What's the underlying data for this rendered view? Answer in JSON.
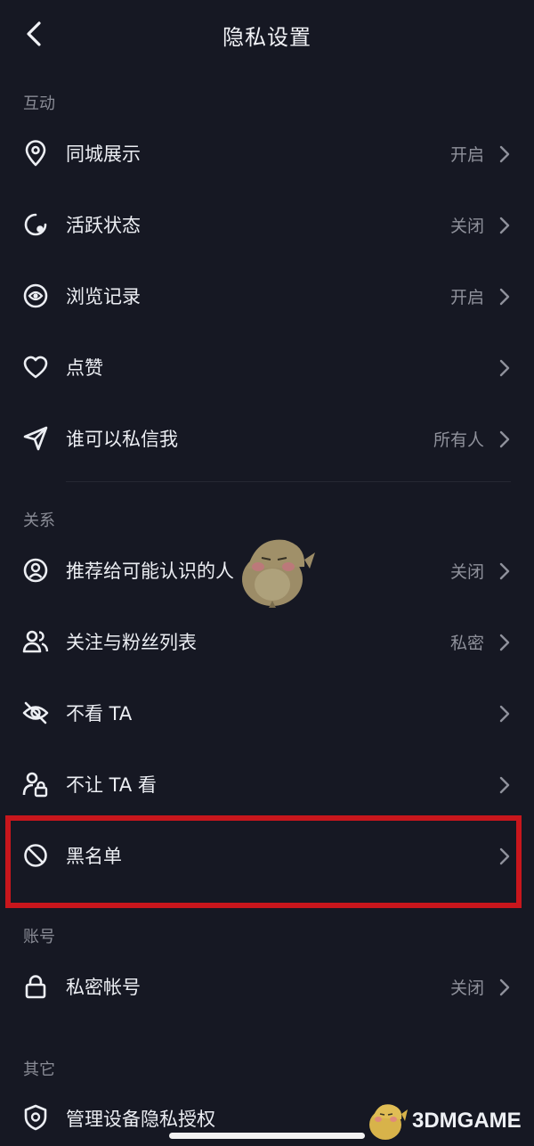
{
  "header": {
    "title": "隐私设置",
    "back_icon": "chevron-left-icon"
  },
  "sections": {
    "interaction": {
      "label": "互动",
      "items": [
        {
          "label": "同城展示",
          "value": "开启",
          "icon": "location-pin-icon"
        },
        {
          "label": "活跃状态",
          "value": "关闭",
          "icon": "activity-status-icon"
        },
        {
          "label": "浏览记录",
          "value": "开启",
          "icon": "eye-icon"
        },
        {
          "label": "点赞",
          "value": "",
          "icon": "heart-icon"
        },
        {
          "label": "谁可以私信我",
          "value": "所有人",
          "icon": "paper-plane-icon"
        }
      ]
    },
    "relations": {
      "label": "关系",
      "items": [
        {
          "label": "推荐给可能认识的人",
          "value": "关闭",
          "icon": "user-circle-icon"
        },
        {
          "label": "关注与粉丝列表",
          "value": "私密",
          "icon": "users-icon"
        },
        {
          "label": "不看 TA",
          "value": "",
          "icon": "eye-off-icon"
        },
        {
          "label": "不让 TA 看",
          "value": "",
          "icon": "user-lock-icon"
        },
        {
          "label": "黑名单",
          "value": "",
          "icon": "block-icon"
        }
      ]
    },
    "account": {
      "label": "账号",
      "items": [
        {
          "label": "私密帐号",
          "value": "关闭",
          "icon": "lock-icon"
        }
      ]
    },
    "other": {
      "label": "其它",
      "items": [
        {
          "label": "管理设备隐私授权",
          "value": "",
          "icon": "shield-icon"
        }
      ]
    }
  },
  "highlight": {
    "target": "黑名单",
    "color": "#c8161c"
  },
  "watermark": {
    "text": "3DMGAME"
  },
  "colors": {
    "background": "#161823",
    "text": "#eceef3",
    "muted": "#8f919b",
    "section": "#8a8c96"
  }
}
